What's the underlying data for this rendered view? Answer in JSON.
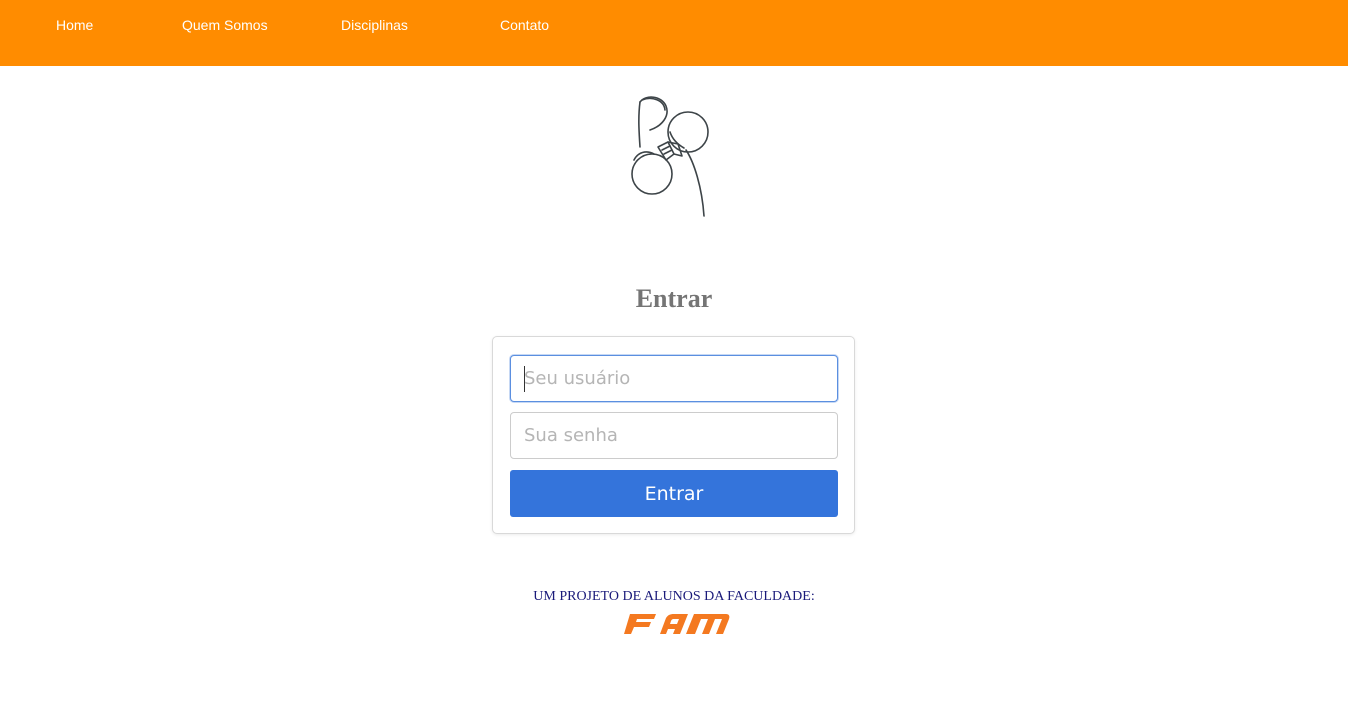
{
  "nav": {
    "items": [
      {
        "label": "Home"
      },
      {
        "label": "Quem Somos"
      },
      {
        "label": "Disciplinas"
      },
      {
        "label": "Contato"
      }
    ],
    "background_color": "#ff8c00"
  },
  "logo": {
    "icon": "hand-drawn-logo-icon"
  },
  "login": {
    "title": "Entrar",
    "username_placeholder": "Seu usuário",
    "username_value": "",
    "password_placeholder": "Sua senha",
    "password_value": "",
    "submit_label": "Entrar",
    "button_color": "#3474db"
  },
  "footer": {
    "text": "UM PROJETO DE ALUNOS DA FACULDADE:",
    "partner_logo_text": "FAM",
    "partner_logo_color": "#f47920"
  }
}
